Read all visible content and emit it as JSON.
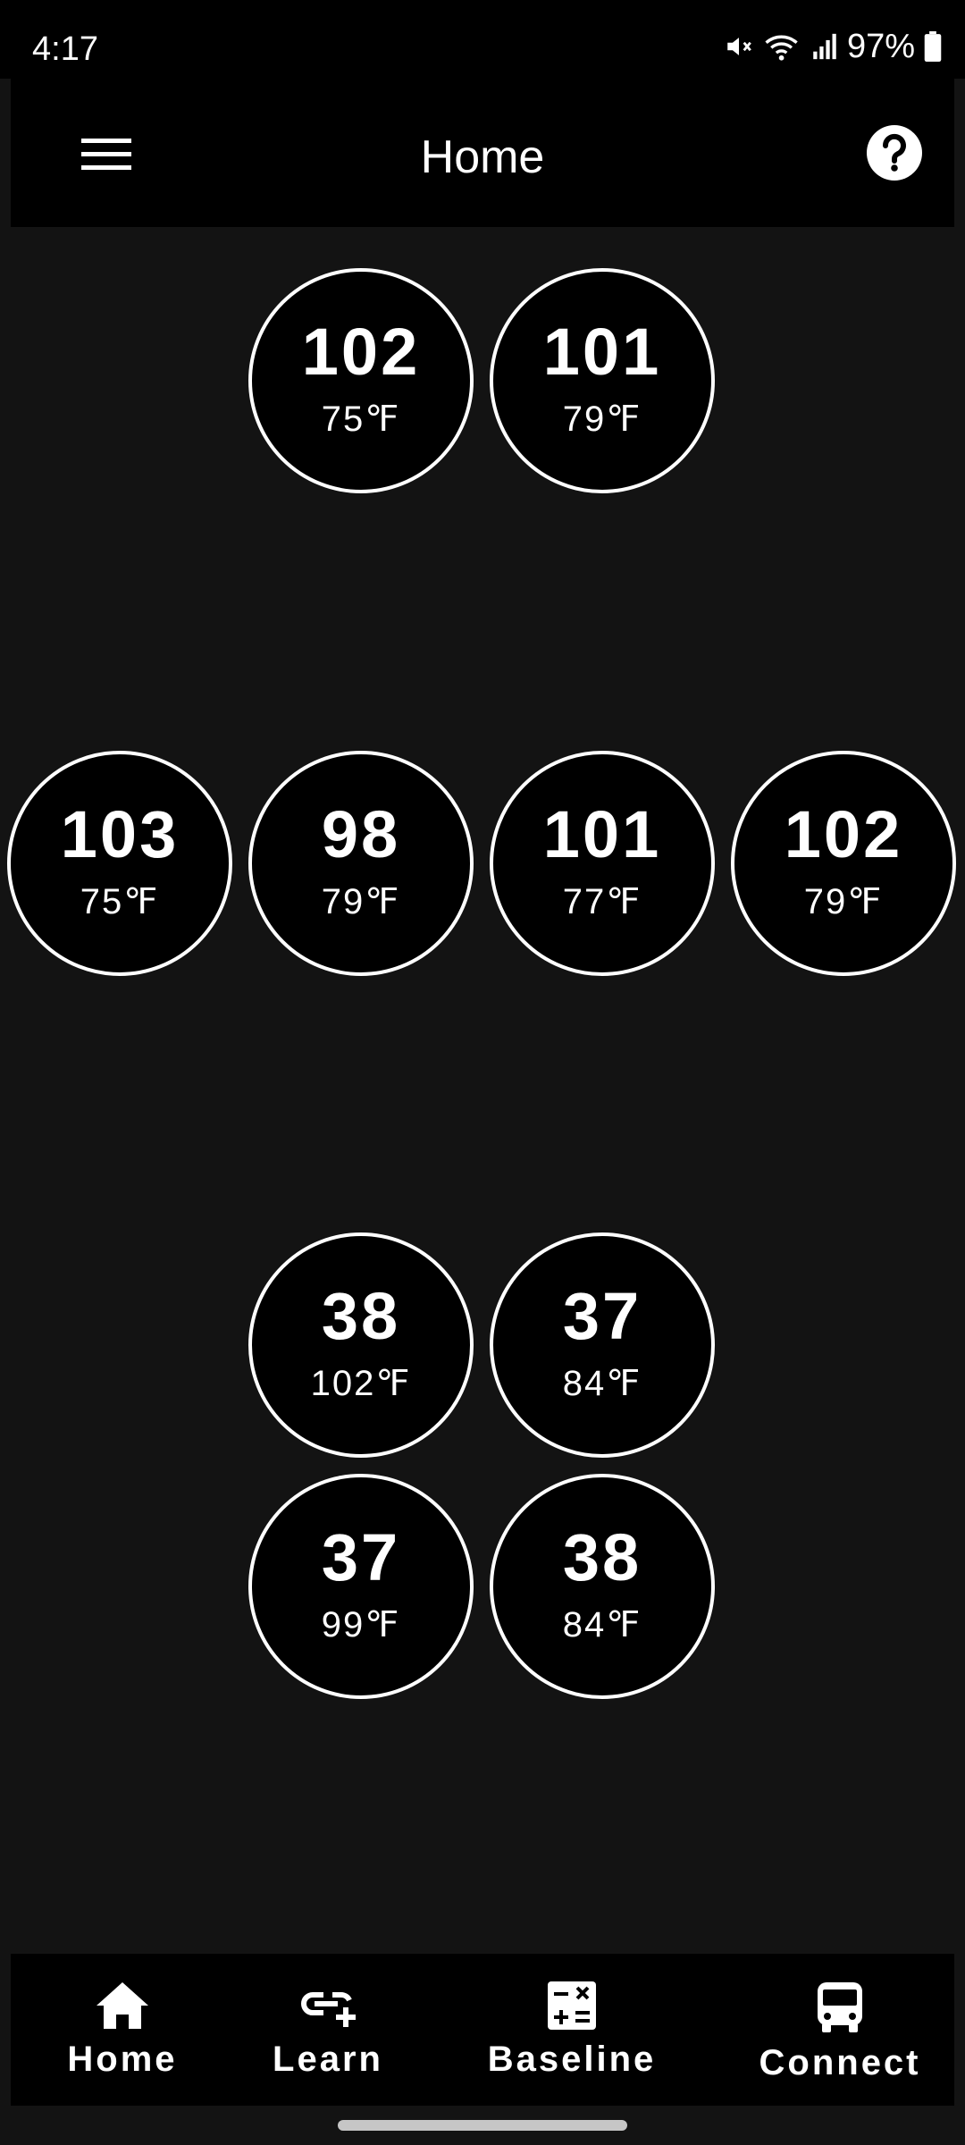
{
  "status_bar": {
    "time": "4:17",
    "battery_percent": "97%",
    "icons": [
      "mute-icon",
      "wifi-icon",
      "signal-icon",
      "battery-icon"
    ]
  },
  "app_bar": {
    "title": "Home",
    "menu_icon": "hamburger-menu-icon",
    "help_icon": "help-icon"
  },
  "gauges": [
    {
      "value": "102",
      "temp": "75℉"
    },
    {
      "value": "101",
      "temp": "79℉"
    },
    {
      "value": "103",
      "temp": "75℉"
    },
    {
      "value": "98",
      "temp": "79℉"
    },
    {
      "value": "101",
      "temp": "77℉"
    },
    {
      "value": "102",
      "temp": "79℉"
    },
    {
      "value": "38",
      "temp": "102℉"
    },
    {
      "value": "37",
      "temp": "84℉"
    },
    {
      "value": "37",
      "temp": "99℉"
    },
    {
      "value": "38",
      "temp": "84℉"
    }
  ],
  "bottom_nav": {
    "items": [
      {
        "label": "Home",
        "icon": "home-icon"
      },
      {
        "label": "Learn",
        "icon": "link-add-icon"
      },
      {
        "label": "Baseline",
        "icon": "calculator-icon"
      },
      {
        "label": "Connect",
        "icon": "bus-icon"
      }
    ]
  },
  "colors": {
    "background": "#131313",
    "bar": "#000000",
    "text": "#ffffff"
  }
}
